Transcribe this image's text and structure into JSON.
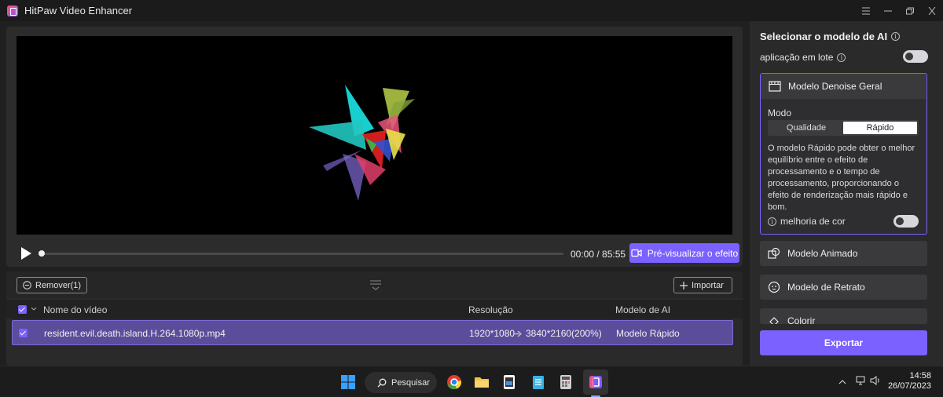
{
  "window": {
    "title": "HitPaw Video Enhancer",
    "controls": [
      "menu-icon",
      "minimize-icon",
      "restore-icon",
      "close-icon"
    ]
  },
  "player": {
    "time": "00:00 / 85:55",
    "progress": 0,
    "preview_label": "Pré-visualizar o efeito"
  },
  "file_list": {
    "remove_label": "Remover(1)",
    "import_label": "Importar",
    "columns": {
      "name": "Nome do vídeo",
      "resolution": "Resolução",
      "model": "Modelo de AI"
    },
    "rows": [
      {
        "name": "resident.evil.death.island.H.264.1080p.mp4",
        "from_res": "1920*1080",
        "to_res": "3840*2160(200%)",
        "model": "Modelo Rápido"
      }
    ]
  },
  "sidebar": {
    "title": "Selecionar o modelo de AI",
    "batch_label": "aplicação em lote",
    "active_model": {
      "name": "Modelo Denoise Geral",
      "mode_label": "Modo",
      "modes": [
        "Qualidade",
        "Rápido"
      ],
      "selected_mode": "Rápido",
      "description": "O modelo Rápido pode obter o melhor equilíbrio entre o efeito de processamento e o tempo de processamento, proporcionando o efeito de renderização mais rápido e bom.",
      "color_label": "melhoria de cor"
    },
    "models": [
      "Modelo Animado",
      "Modelo de Retrato",
      "Colorir"
    ],
    "export_label": "Exportar"
  },
  "taskbar": {
    "search_label": "Pesquisar",
    "time": "14:58",
    "date": "26/07/2023"
  },
  "colors": {
    "accent": "#7b61ff",
    "row_selected": "#5b4d9a"
  }
}
